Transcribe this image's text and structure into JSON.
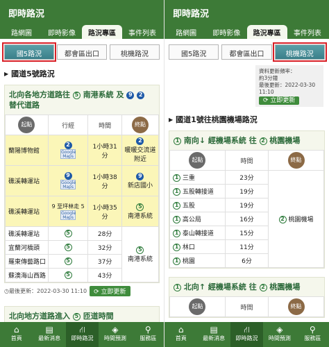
{
  "left": {
    "title": "即時路況",
    "tabs": [
      "路網圖",
      "即時影像",
      "路況專區",
      "事件列表"
    ],
    "segments": [
      "國5路況",
      "都會區出口",
      "桃機路況"
    ],
    "section": "國道5號路況",
    "card1": {
      "heading_pre": "北向各地方道路往",
      "heading_mid": "南港系統 及",
      "heading_post": "替代道路",
      "shield1": "5",
      "shield2": "9",
      "shield3": "2",
      "col_origin": "起點",
      "col_route": "行經",
      "col_time": "時間",
      "col_dest": "終點",
      "rows": [
        {
          "origin": "蘭陽博物館",
          "route": "2",
          "time": "1小時31分",
          "dest": "暖暖交流道附近",
          "dest_shield": "2"
        },
        {
          "origin": "礁溪轉運站",
          "route": "9",
          "time": "1小時38分",
          "dest": "新店國小",
          "dest_shield": "9"
        },
        {
          "origin": "礁溪轉運站",
          "route": "9 至坪林走 5",
          "time": "1小時35分",
          "dest": "南港系統",
          "dest_shield": "5"
        },
        {
          "origin": "礁溪轉運站",
          "route": "5",
          "time": "28分",
          "dest": "",
          "dest_shield": ""
        },
        {
          "origin": "宜蘭河橋頭",
          "route": "5",
          "time": "32分",
          "dest": "",
          "dest_shield": ""
        },
        {
          "origin": "羅東傳藝路口",
          "route": "5",
          "time": "37分",
          "dest": "南港系統",
          "dest_shield": "5"
        },
        {
          "origin": "蘇澳海山西路",
          "route": "5",
          "time": "43分",
          "dest": "",
          "dest_shield": ""
        }
      ],
      "gmaps_label": "Google Maps"
    },
    "last_update": "最後更新：2022-03-30 11:10",
    "refresh": "立即更新",
    "card2_heading": "北向地方道路進入",
    "card2_heading_post": "匝道時間",
    "card2_shield": "5"
  },
  "right": {
    "title": "即時路況",
    "tabs": [
      "路網圖",
      "即時影像",
      "路況專區",
      "事件列表"
    ],
    "segments": [
      "國5路況",
      "都會區出口",
      "桃機路況"
    ],
    "info": [
      "資料更新頻率：",
      "約3分鐘",
      "最後更新：2022-03-30 11:10"
    ],
    "refresh": "立即更新",
    "section": "國道1號往桃園機場路況",
    "south": {
      "heading": "南向↓  經機場系統  往",
      "heading_post": "桃園機場",
      "shield1": "1",
      "shield2": "2",
      "col_origin": "起點",
      "col_time": "時間",
      "col_dest": "終點",
      "rows": [
        {
          "origin": "三重",
          "time": "23分"
        },
        {
          "origin": "五股轉接道",
          "time": "19分"
        },
        {
          "origin": "五股",
          "time": "19分"
        },
        {
          "origin": "高公局",
          "time": "16分"
        },
        {
          "origin": "泰山轉接道",
          "time": "15分"
        },
        {
          "origin": "林口",
          "time": "11分"
        },
        {
          "origin": "桃園",
          "time": "6分"
        }
      ],
      "dest": "桃園機場"
    },
    "north": {
      "heading": "北向↑  經機場系統  往",
      "heading_post": "桃園機場",
      "shield1": "1",
      "shield2": "2",
      "col_origin": "起點",
      "col_time": "時間",
      "col_dest": "終點"
    }
  },
  "bottom_nav": [
    "首頁",
    "最新消息",
    "即時路況",
    "時間預測",
    "服務區"
  ]
}
